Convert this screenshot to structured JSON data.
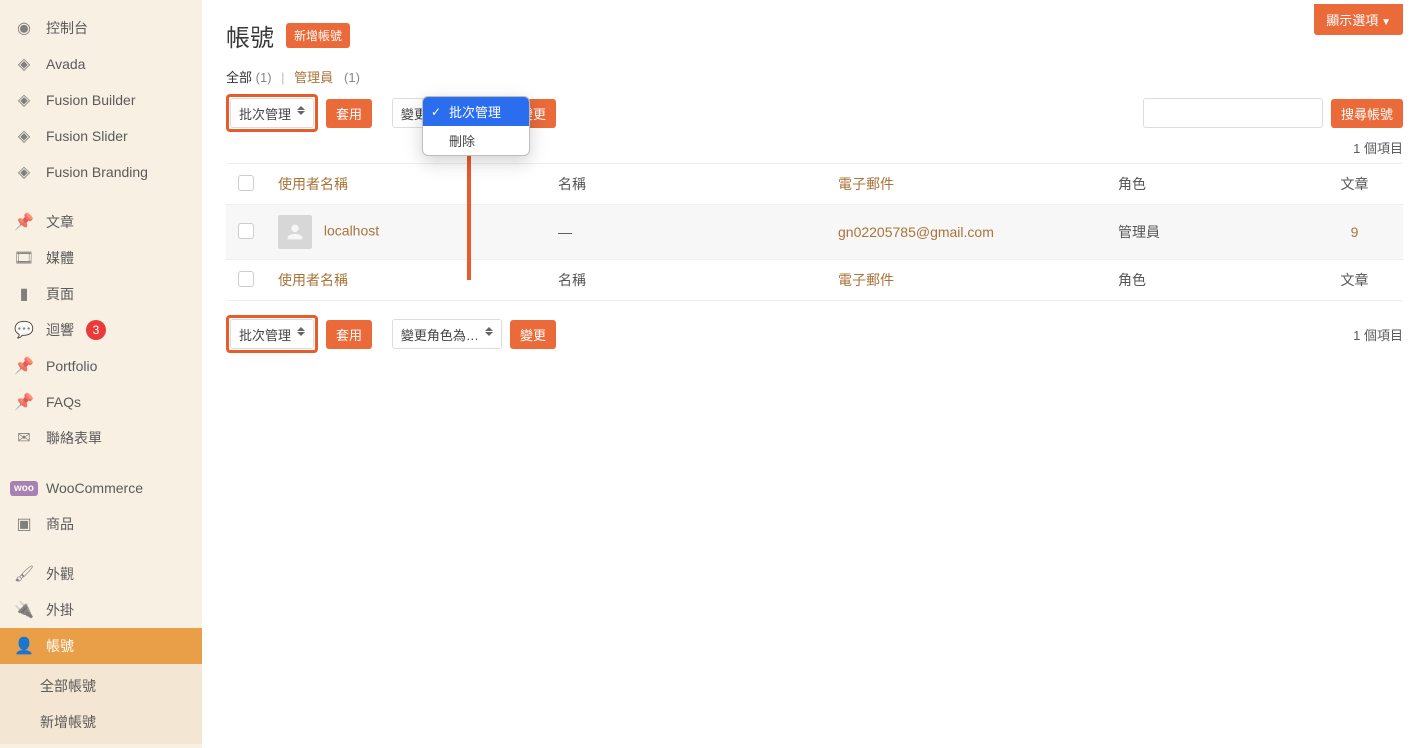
{
  "sidebar": {
    "items": [
      {
        "label": "控制台",
        "icon": "dashboard"
      },
      {
        "label": "Avada",
        "icon": "avada"
      },
      {
        "label": "Fusion Builder",
        "icon": "avada"
      },
      {
        "label": "Fusion Slider",
        "icon": "avada"
      },
      {
        "label": "Fusion Branding",
        "icon": "avada"
      },
      {
        "label": "文章",
        "icon": "pin"
      },
      {
        "label": "媒體",
        "icon": "media"
      },
      {
        "label": "頁面",
        "icon": "page"
      },
      {
        "label": "迴響",
        "icon": "comment",
        "badge": "3"
      },
      {
        "label": "Portfolio",
        "icon": "pin"
      },
      {
        "label": "FAQs",
        "icon": "pin"
      },
      {
        "label": "聯絡表單",
        "icon": "envelope"
      },
      {
        "label": "WooCommerce",
        "icon": "woo"
      },
      {
        "label": "商品",
        "icon": "archive"
      },
      {
        "label": "外觀",
        "icon": "brush"
      },
      {
        "label": "外掛",
        "icon": "plug"
      },
      {
        "label": "帳號",
        "icon": "user",
        "active": true
      }
    ],
    "sub": [
      {
        "label": "全部帳號"
      },
      {
        "label": "新增帳號"
      }
    ]
  },
  "header": {
    "title": "帳號",
    "add_new": "新增帳號",
    "screen_options": "顯示選項"
  },
  "subsub": {
    "all_label": "全部",
    "all_count": "(1)",
    "admin_label": "管理員",
    "admin_count": "(1)"
  },
  "filters": {
    "bulk_label": "批次管理",
    "apply_label": "套用",
    "role_label": "變更角色為…",
    "change_label": "變更",
    "count_info": "1 個項目",
    "search_button": "搜尋帳號"
  },
  "dropdown": {
    "opt_bulk": "批次管理",
    "opt_delete": "刪除"
  },
  "table": {
    "headers": {
      "username": "使用者名稱",
      "name": "名稱",
      "email": "電子郵件",
      "role": "角色",
      "posts": "文章"
    },
    "rows": [
      {
        "username": "localhost",
        "name": "—",
        "email": "gn02205785@gmail.com",
        "role": "管理員",
        "posts": "9"
      }
    ]
  }
}
